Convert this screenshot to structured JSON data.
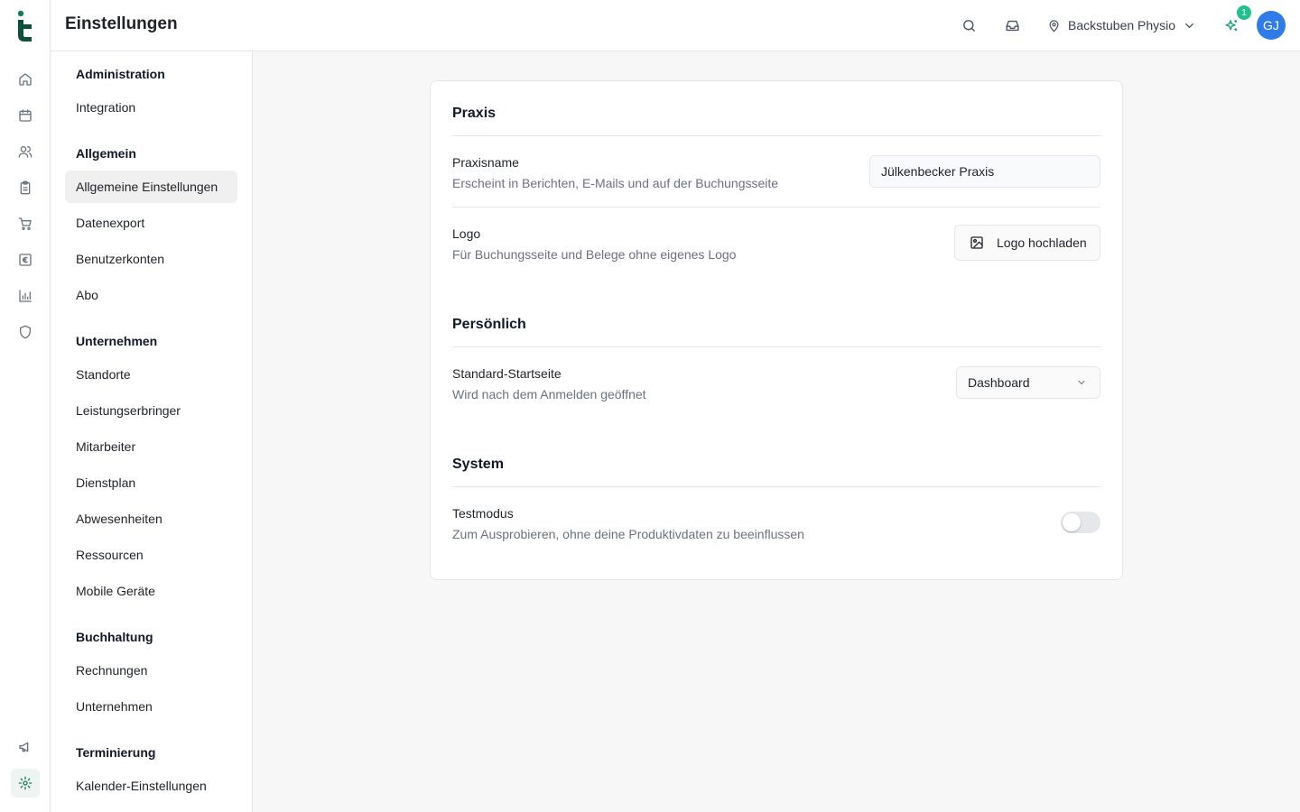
{
  "header": {
    "title": "Einstellungen",
    "location": "Backstuben Physio",
    "notification_count": "1",
    "avatar_initials": "GJ"
  },
  "rail": {
    "items": [
      "home-icon",
      "calendar-icon",
      "users-icon",
      "clipboard-icon",
      "cart-icon",
      "euro-icon",
      "chart-icon",
      "shield-icon"
    ],
    "bottom": [
      "megaphone-icon",
      "gear-icon"
    ],
    "accent": "#1a7a5e"
  },
  "nav": {
    "groups": [
      {
        "title": "Administration",
        "items": [
          "Integration"
        ]
      },
      {
        "title": "Allgemein",
        "items": [
          "Allgemeine Einstellungen",
          "Datenexport",
          "Benutzerkonten",
          "Abo"
        ]
      },
      {
        "title": "Unternehmen",
        "items": [
          "Standorte",
          "Leistungserbringer",
          "Mitarbeiter",
          "Dienstplan",
          "Abwesenheiten",
          "Ressourcen",
          "Mobile Geräte"
        ]
      },
      {
        "title": "Buchhaltung",
        "items": [
          "Rechnungen",
          "Unternehmen"
        ]
      },
      {
        "title": "Terminierung",
        "items": [
          "Kalender-Einstellungen"
        ]
      }
    ],
    "active": "Allgemeine Einstellungen"
  },
  "sections": {
    "praxis": {
      "title": "Praxis",
      "name_label": "Praxisname",
      "name_desc": "Erscheint in Berichten, E-Mails und auf der Buchungsseite",
      "name_value": "Jülkenbecker Praxis",
      "logo_label": "Logo",
      "logo_desc": "Für Buchungsseite und Belege ohne eigenes Logo",
      "logo_button": "Logo hochladen"
    },
    "personal": {
      "title": "Persönlich",
      "start_label": "Standard-Startseite",
      "start_desc": "Wird nach dem Anmelden geöffnet",
      "start_value": "Dashboard"
    },
    "system": {
      "title": "System",
      "test_label": "Testmodus",
      "test_desc": "Zum Ausprobieren, ohne deine Produktivdaten zu beeinflussen",
      "test_enabled": false
    }
  }
}
